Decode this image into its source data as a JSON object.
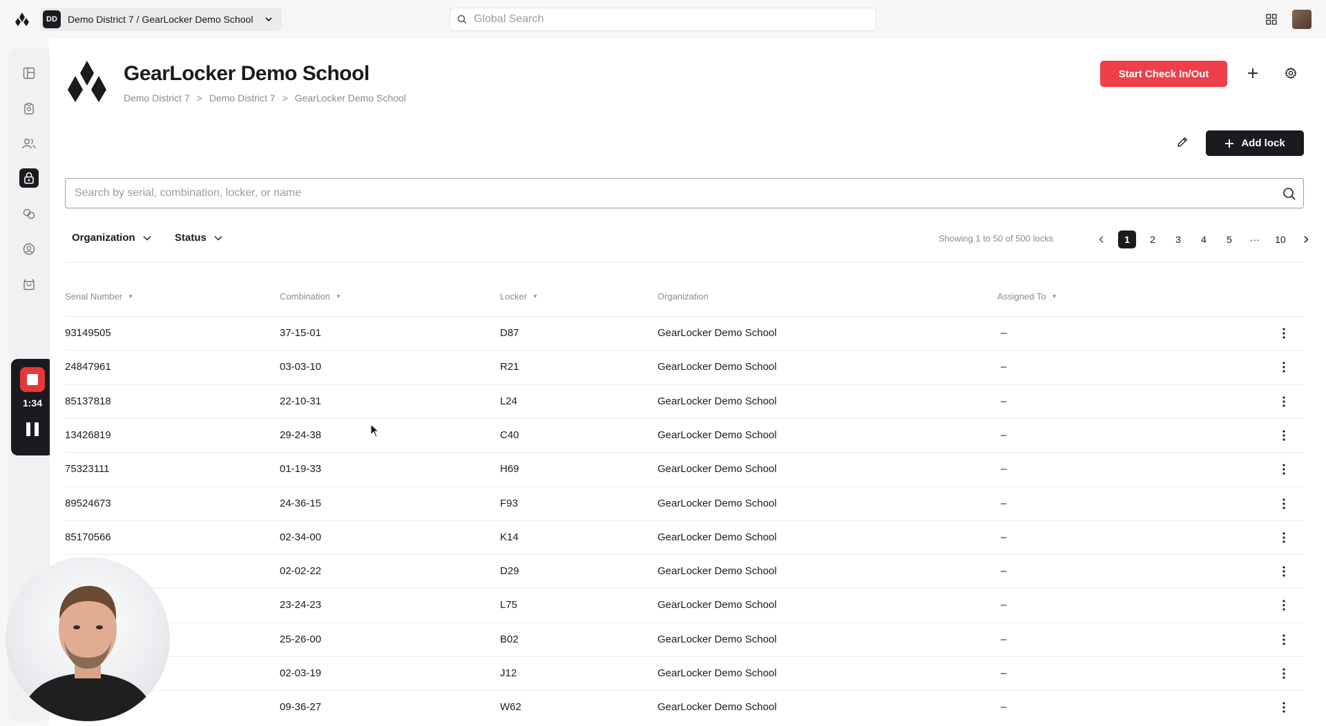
{
  "topbar": {
    "org_badge": "DD",
    "org_path": "Demo District 7 / GearLocker Demo School",
    "search_placeholder": "Global Search"
  },
  "sidebar": {
    "items": [
      {
        "icon": "dashboard-icon"
      },
      {
        "icon": "clipboard-icon"
      },
      {
        "icon": "users-icon"
      },
      {
        "icon": "lock-icon",
        "active": true
      },
      {
        "icon": "swap-icon"
      },
      {
        "icon": "account-circle-icon"
      },
      {
        "icon": "shopping-bag-icon"
      }
    ]
  },
  "recorder": {
    "time": "1:34"
  },
  "header": {
    "title": "GearLocker Demo School",
    "breadcrumb": [
      "Demo District 7",
      "Demo District 7",
      "GearLocker Demo School"
    ],
    "breadcrumb_sep": ">",
    "checkin_label": "Start Check In/Out",
    "add_lock_label": "Add lock"
  },
  "search": {
    "placeholder": "Search by serial, combination, locker, or name"
  },
  "filters": {
    "organization": "Organization",
    "status": "Status"
  },
  "pagination": {
    "showing": "Showing 1 to 50 of 500 locks",
    "pages": [
      "1",
      "2",
      "3",
      "4",
      "5",
      "···",
      "10"
    ],
    "current": "1"
  },
  "table": {
    "columns": {
      "serial": "Serial Number",
      "combination": "Combination",
      "locker": "Locker",
      "organization": "Organization",
      "assigned": "Assigned To"
    },
    "rows": [
      {
        "serial": "93149505",
        "combination": "37-15-01",
        "locker": "D87",
        "organization": "GearLocker Demo School",
        "assigned": "–"
      },
      {
        "serial": "24847961",
        "combination": "03-03-10",
        "locker": "R21",
        "organization": "GearLocker Demo School",
        "assigned": "–"
      },
      {
        "serial": "85137818",
        "combination": "22-10-31",
        "locker": "L24",
        "organization": "GearLocker Demo School",
        "assigned": "–"
      },
      {
        "serial": "13426819",
        "combination": "29-24-38",
        "locker": "C40",
        "organization": "GearLocker Demo School",
        "assigned": "–"
      },
      {
        "serial": "75323111",
        "combination": "01-19-33",
        "locker": "H69",
        "organization": "GearLocker Demo School",
        "assigned": "–"
      },
      {
        "serial": "89524673",
        "combination": "24-36-15",
        "locker": "F93",
        "organization": "GearLocker Demo School",
        "assigned": "–"
      },
      {
        "serial": "85170566",
        "combination": "02-34-00",
        "locker": "K14",
        "organization": "GearLocker Demo School",
        "assigned": "–"
      },
      {
        "serial": "",
        "combination": "02-02-22",
        "locker": "D29",
        "organization": "GearLocker Demo School",
        "assigned": "–"
      },
      {
        "serial": "",
        "combination": "23-24-23",
        "locker": "L75",
        "organization": "GearLocker Demo School",
        "assigned": "–"
      },
      {
        "serial": "",
        "combination": "25-26-00",
        "locker": "B02",
        "organization": "GearLocker Demo School",
        "assigned": "–"
      },
      {
        "serial": "",
        "combination": "02-03-19",
        "locker": "J12",
        "organization": "GearLocker Demo School",
        "assigned": "–"
      },
      {
        "serial": "",
        "combination": "09-36-27",
        "locker": "W62",
        "organization": "GearLocker Demo School",
        "assigned": "–"
      }
    ]
  },
  "colors": {
    "accent": "#ef3f4a",
    "dark": "#1b1b1f",
    "muted": "#8a8a93"
  }
}
